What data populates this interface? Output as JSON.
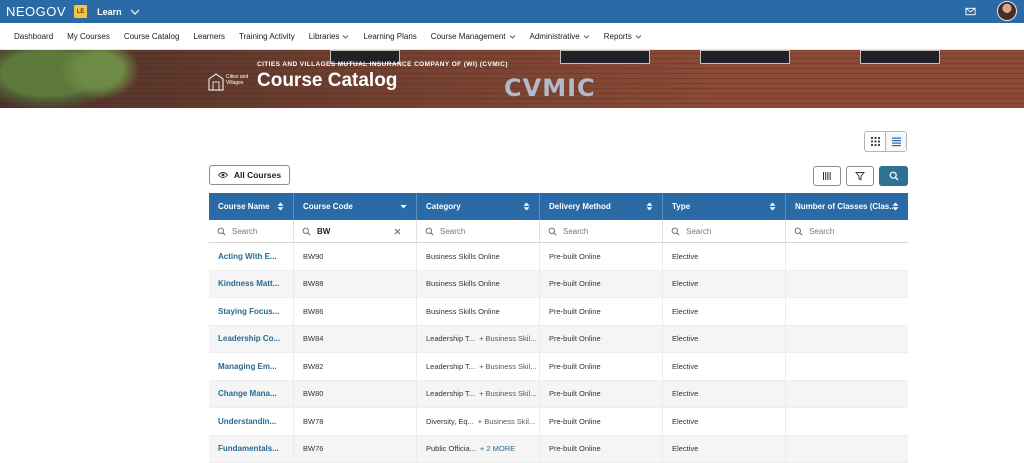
{
  "topbar": {
    "brand": "NEOGOV",
    "badge": "LE",
    "product": "Learn"
  },
  "nav": [
    {
      "label": "Dashboard",
      "dropdown": false
    },
    {
      "label": "My Courses",
      "dropdown": false
    },
    {
      "label": "Course Catalog",
      "dropdown": false
    },
    {
      "label": "Learners",
      "dropdown": false
    },
    {
      "label": "Training Activity",
      "dropdown": false
    },
    {
      "label": "Libraries",
      "dropdown": true
    },
    {
      "label": "Learning Plans",
      "dropdown": false
    },
    {
      "label": "Course Management",
      "dropdown": true
    },
    {
      "label": "Administrative",
      "dropdown": true
    },
    {
      "label": "Reports",
      "dropdown": true
    }
  ],
  "banner": {
    "subtitle": "CITIES AND VILLAGES MUTUAL INSURANCE COMPANY OF (WI) (CVMIC)",
    "title": "Course Catalog",
    "wall_sign": "CVMIC",
    "logo_text": "Cities and Villages"
  },
  "filters": {
    "all_courses_label": "All Courses"
  },
  "table": {
    "columns": [
      {
        "label": "Course Name",
        "sort": "both"
      },
      {
        "label": "Course Code",
        "sort": "desc"
      },
      {
        "label": "Category",
        "sort": "both"
      },
      {
        "label": "Delivery Method",
        "sort": "both"
      },
      {
        "label": "Type",
        "sort": "both"
      },
      {
        "label": "Number of Classes (Clas...",
        "sort": "both"
      }
    ],
    "search_placeholder": "Search",
    "code_filter_value": "BW",
    "rows": [
      {
        "name": "Acting With E...",
        "code": "BW90",
        "category": "Business Skills Online",
        "more": "",
        "delivery": "Pre-built Online",
        "type": "Elective",
        "classes": ""
      },
      {
        "name": "Kindness Matt...",
        "code": "BW88",
        "category": "Business Skills Online",
        "more": "",
        "delivery": "Pre-built Online",
        "type": "Elective",
        "classes": ""
      },
      {
        "name": "Staying Focus...",
        "code": "BW86",
        "category": "Business Skills Online",
        "more": "",
        "delivery": "Pre-built Online",
        "type": "Elective",
        "classes": ""
      },
      {
        "name": "Leadership Co...",
        "code": "BW84",
        "category": "Leadership T...",
        "more": "+ Business Skil...",
        "delivery": "Pre-built Online",
        "type": "Elective",
        "classes": ""
      },
      {
        "name": "Managing Em...",
        "code": "BW82",
        "category": "Leadership T...",
        "more": "+ Business Skil...",
        "delivery": "Pre-built Online",
        "type": "Elective",
        "classes": ""
      },
      {
        "name": "Change Mana...",
        "code": "BW80",
        "category": "Leadership T...",
        "more": "+ Business Skil...",
        "delivery": "Pre-built Online",
        "type": "Elective",
        "classes": ""
      },
      {
        "name": "Understandin...",
        "code": "BW78",
        "category": "Diversity, Eq...",
        "more": "+ Business Skil...",
        "delivery": "Pre-built Online",
        "type": "Elective",
        "classes": ""
      },
      {
        "name": "Fundamentals...",
        "code": "BW76",
        "category": "Public Officia...",
        "more": "+ 2 MORE",
        "delivery": "Pre-built Online",
        "type": "Elective",
        "classes": ""
      }
    ]
  },
  "colors": {
    "header_blue": "#2a6aa6",
    "link_blue": "#2b6a8f",
    "search_teal": "#2f7190",
    "badge_yellow": "#f5c24a"
  },
  "icons": [
    "chevron-down-icon",
    "mail-icon",
    "grid-view-icon",
    "list-view-icon",
    "eye-icon",
    "columns-icon",
    "filter-icon",
    "search-icon",
    "sort-icon",
    "clear-icon"
  ]
}
